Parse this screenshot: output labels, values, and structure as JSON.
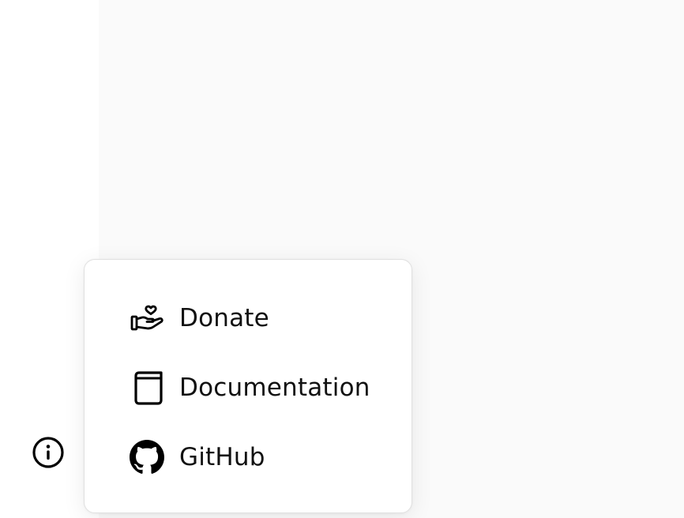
{
  "menu": {
    "items": [
      {
        "label": "Donate",
        "icon": "donate-hand-heart-icon"
      },
      {
        "label": "Documentation",
        "icon": "book-icon"
      },
      {
        "label": "GitHub",
        "icon": "github-icon"
      }
    ]
  },
  "info_button": {
    "icon": "info-circle-icon"
  }
}
